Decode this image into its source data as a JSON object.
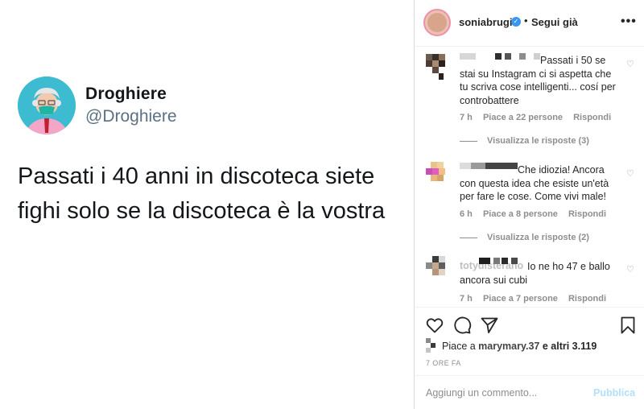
{
  "tweet": {
    "name": "Droghiere",
    "handle": "@Droghiere",
    "text": "Passati i 40 anni in discoteca siete fighi solo se la discoteca è la vostra"
  },
  "header": {
    "username": "soniabrugi",
    "dot": "•",
    "follow_label": "Segui già",
    "more": "•••"
  },
  "comments": [
    {
      "text": "Passati i 50 se stai su Instagram ci si aspetta che tu scriva cose intelligenti... cosí per controbattere",
      "time": "7 h",
      "likes": "Piace a 22 persone",
      "reply": "Rispondi",
      "view_replies": "Visualizza le risposte (3)"
    },
    {
      "text": "Che idiozia! Ancora con questa idea che esiste un'età per fare le cose. Come vivi male!",
      "time": "6 h",
      "likes": "Piace a 8 persone",
      "reply": "Rispondi",
      "view_replies": "Visualizza le risposte (2)"
    },
    {
      "user": "totydisterano",
      "text": "Io ne ho 47 e ballo ancora sui cubi",
      "time": "7 h",
      "likes": "Piace a 7 persone",
      "reply": "Rispondi"
    }
  ],
  "likes_row": {
    "prefix": "Piace a ",
    "user": "marymary.37",
    "suffix": " e altri 3.119"
  },
  "post_time": "7 ORE FA",
  "add_comment": {
    "placeholder": "Aggiungi un commento...",
    "publish": "Pubblica"
  },
  "colors": {
    "accent_blue": "#3897f0",
    "publish_disabled": "#b2dffc",
    "tweet_avatar_bg": "#3dbcd1"
  }
}
